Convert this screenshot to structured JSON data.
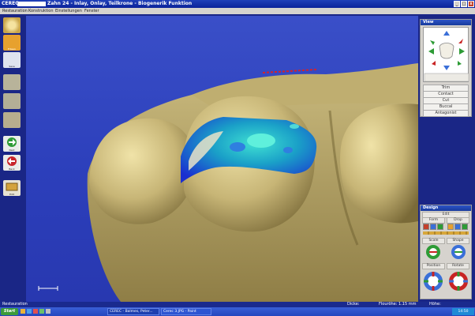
{
  "window": {
    "app_title": "CEREC",
    "doc_title": "Zahn 24 - Inlay, Onlay, Teilkrone - Biogenerik Funktion",
    "min": "_",
    "max": "□",
    "close": "x"
  },
  "menu": [
    "Restauration",
    "Konstruktion",
    "Einstellungen",
    "Fenster"
  ],
  "left_tools": [
    {
      "label": "Fräsen",
      "icon": "restoration-icon"
    },
    {
      "label": "Save",
      "icon": "save-icon"
    },
    {
      "label": "Analyze",
      "icon": "analyze-icon"
    },
    {
      "label": "Preparation",
      "icon": "preparation-icon"
    },
    {
      "label": "Margin",
      "icon": "margin-icon"
    },
    {
      "label": "Next",
      "icon": "next-arrow-icon"
    },
    {
      "label": "Back",
      "icon": "back-arrow-icon"
    },
    {
      "label": "Edit",
      "icon": "edit-icon"
    }
  ],
  "view_panel": {
    "title": "View",
    "buttons": [
      "Trim",
      "Contact",
      "Cut",
      "Buccal",
      "Antagonist"
    ]
  },
  "design_panel": {
    "title": "Design",
    "edit_label": "Edit",
    "form": "Form",
    "drop": "Drop",
    "scale": "Scale",
    "shape": "Shape",
    "position": "Position",
    "rotate": "Rotate"
  },
  "status": {
    "left": "Restauration",
    "dicke": "Dicke:",
    "flaeche": "Flouröhe: 1.15 mm",
    "hoehe": "Höhe:"
  },
  "taskbar": {
    "start": "Start",
    "tasks": [
      "CEREC - Balmes, Peter...",
      "Cerec 3.JPG - Paint"
    ],
    "clock": "14:50"
  },
  "colors": {
    "tooth": "#c9b97d",
    "restoration_blue": "#2234d4",
    "restoration_cyan": "#36d0cf",
    "viewport_bg": "#2f43be"
  }
}
